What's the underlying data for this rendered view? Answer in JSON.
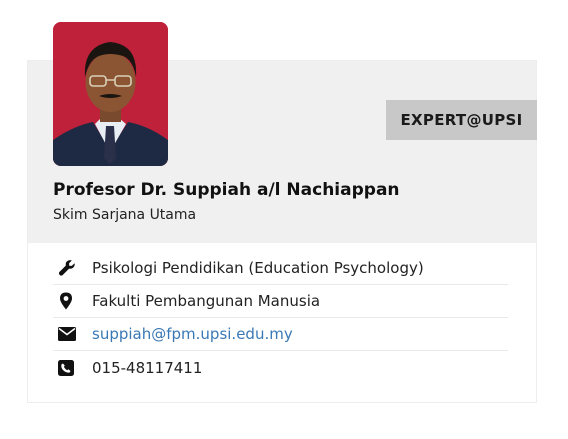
{
  "card": {
    "badge": "EXPERT@UPSI",
    "name": "Profesor Dr. Suppiah a/l Nachiappan",
    "position": "Skim Sarjana Utama",
    "photo_background": "#c0213a"
  },
  "info": {
    "expertise": "Psikologi Pendidikan (Education Psychology)",
    "faculty": "Fakulti Pembangunan Manusia",
    "email": "suppiah@fpm.upsi.edu.my",
    "phone": "015-48117411",
    "icons": [
      "wrench-icon",
      "map-marker-icon",
      "envelope-icon",
      "phone-icon"
    ]
  },
  "colors": {
    "header_bg": "#f0f0f0",
    "badge_bg": "#c8c8c8",
    "link": "#3a78b5"
  }
}
